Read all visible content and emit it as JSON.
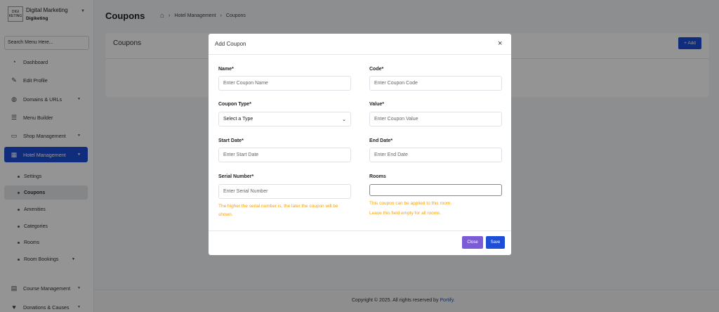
{
  "brand": {
    "name": "Digital Marketing",
    "sub": "Digiketing",
    "logo_text": "DIGI KETING"
  },
  "sidebar": {
    "search_placeholder": "Search Menu Here...",
    "items": [
      {
        "label": "Dashboard",
        "icon": "dashboard-icon"
      },
      {
        "label": "Edit Profile",
        "icon": "user-edit-icon"
      },
      {
        "label": "Domains & URLs",
        "icon": "globe-icon"
      },
      {
        "label": "Menu Builder",
        "icon": "menu-icon"
      },
      {
        "label": "Shop Management",
        "icon": "shop-icon"
      },
      {
        "label": "Hotel Management",
        "icon": "hotel-icon"
      }
    ],
    "sub_items": [
      {
        "label": "Settings"
      },
      {
        "label": "Coupons"
      },
      {
        "label": "Amenities"
      },
      {
        "label": "Categories"
      },
      {
        "label": "Rooms"
      },
      {
        "label": "Room Bookings"
      }
    ],
    "bottom_items": [
      {
        "label": "Course Management",
        "icon": "course-icon"
      },
      {
        "label": "Donations & Causes",
        "icon": "donation-icon"
      }
    ]
  },
  "header": {
    "title": "Coupons",
    "breadcrumb": [
      "Hotel Management",
      "Coupons"
    ]
  },
  "card": {
    "title": "Coupons",
    "add_label": "+ Add"
  },
  "footer": {
    "text": "Copyright © 2025. All rights reserved by ",
    "link": "Portify."
  },
  "modal": {
    "title": "Add Coupon",
    "close_glyph": "×",
    "fields": {
      "name": {
        "label": "Name*",
        "placeholder": "Enter Coupon Name"
      },
      "code": {
        "label": "Code*",
        "placeholder": "Enter Coupon Code"
      },
      "type": {
        "label": "Coupon Type*",
        "value": "Select a Type"
      },
      "value": {
        "label": "Value*",
        "placeholder": "Enter Coupon Value"
      },
      "start": {
        "label": "Start Date*",
        "placeholder": "Enter Start Date"
      },
      "end": {
        "label": "End Date*",
        "placeholder": "Enter End Date"
      },
      "serial": {
        "label": "Serial Number*",
        "placeholder": "Enter Serial Number",
        "hint": "The higher the serial number is, the later the coupon will be shown."
      },
      "rooms": {
        "label": "Rooms",
        "value": "",
        "hint1": "This coupon can be applied to this room.",
        "hint2": "Leave this field empty for all rooms."
      }
    },
    "close_label": "Close",
    "save_label": "Save"
  },
  "colors": {
    "primary": "#1d4ed8",
    "secondary": "#7c5cd6",
    "hint": "#f59e0b"
  }
}
